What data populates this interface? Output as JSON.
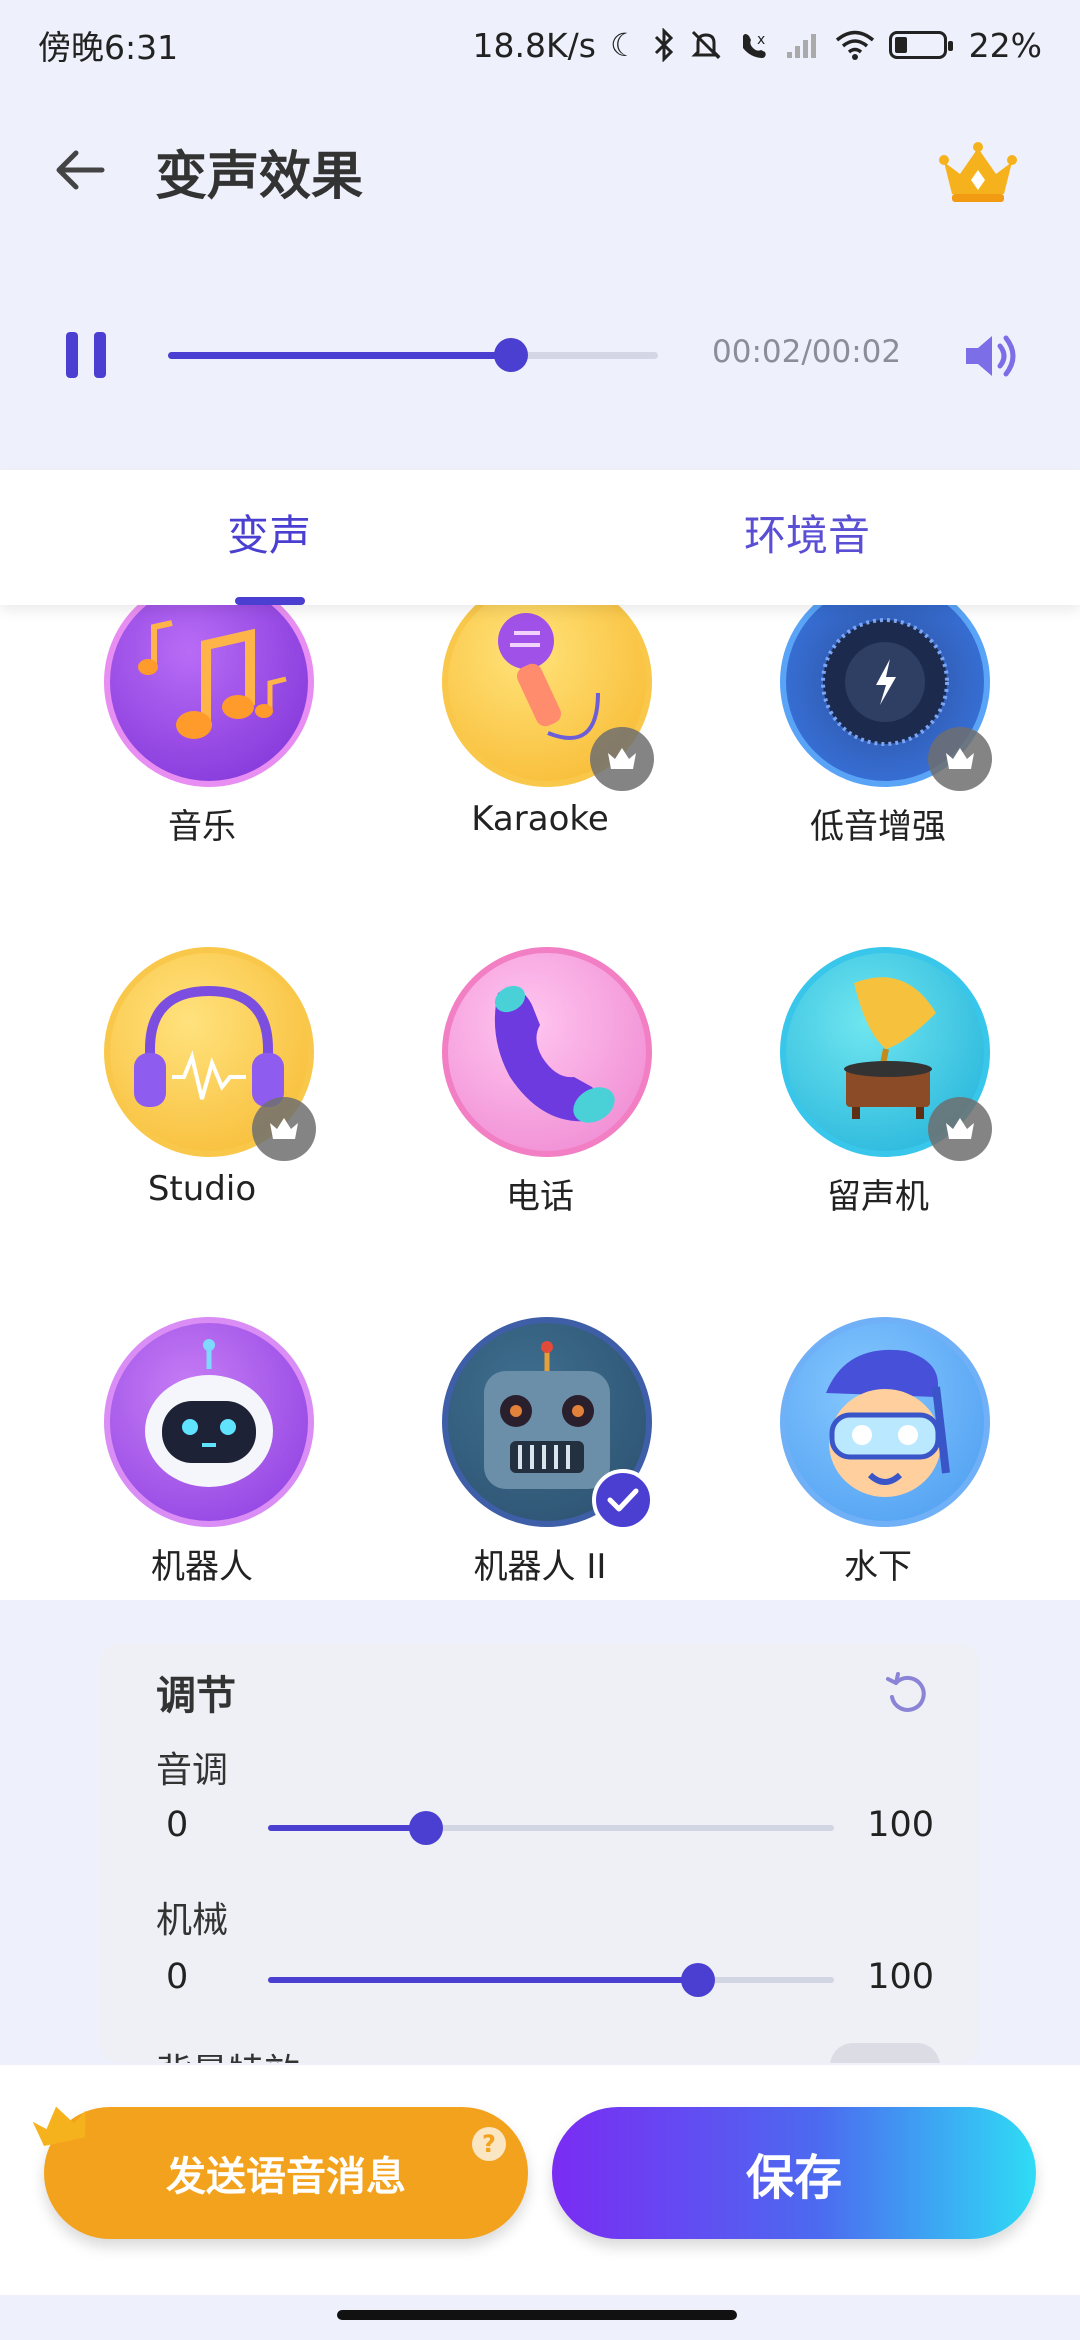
{
  "status_bar": {
    "time": "傍晚6:31",
    "network_speed": "18.8K/s",
    "battery_percent": "22%",
    "icons": [
      "moon-icon",
      "bluetooth-icon",
      "mute-icon",
      "call-forward-icon",
      "signal-icon",
      "wifi-icon",
      "battery-icon"
    ]
  },
  "header": {
    "title": "变声效果"
  },
  "player": {
    "time": "00:02/00:02",
    "progress": 0.7,
    "state": "playing"
  },
  "tabs": [
    {
      "label": "变声",
      "active": true
    },
    {
      "label": "环境音",
      "active": false
    }
  ],
  "effects": [
    {
      "label": "音乐",
      "icon": "music-notes-icon",
      "vip": false,
      "selected": false
    },
    {
      "label": "Karaoke",
      "icon": "microphone-icon",
      "vip": true,
      "selected": false
    },
    {
      "label": "低音增强",
      "icon": "bass-knob-icon",
      "vip": true,
      "selected": false
    },
    {
      "label": "Studio",
      "icon": "headphones-icon",
      "vip": true,
      "selected": false
    },
    {
      "label": "电话",
      "icon": "phone-icon",
      "vip": false,
      "selected": false
    },
    {
      "label": "留声机",
      "icon": "gramophone-icon",
      "vip": true,
      "selected": false
    },
    {
      "label": "机器人",
      "icon": "robot-face-icon",
      "vip": false,
      "selected": false
    },
    {
      "label": "机器人 II",
      "icon": "robot-head-icon",
      "vip": false,
      "selected": true
    },
    {
      "label": "水下",
      "icon": "diver-icon",
      "vip": false,
      "selected": false
    }
  ],
  "adjust": {
    "title": "调节",
    "params": [
      {
        "label": "音调",
        "min": "0",
        "max": "100",
        "value": 0.28
      },
      {
        "label": "机械",
        "min": "0",
        "max": "100",
        "value": 0.76
      }
    ],
    "background_effect_label": "背景特效",
    "background_effect_on": false
  },
  "bottom": {
    "send_label": "发送语音消息",
    "help_mark": "?",
    "save_label": "保存"
  },
  "colors": {
    "accent": "#4a3fd0",
    "send_button": "#f3a21d",
    "save_gradient_start": "#7a2cf3",
    "save_gradient_end": "#2fdcf5"
  }
}
